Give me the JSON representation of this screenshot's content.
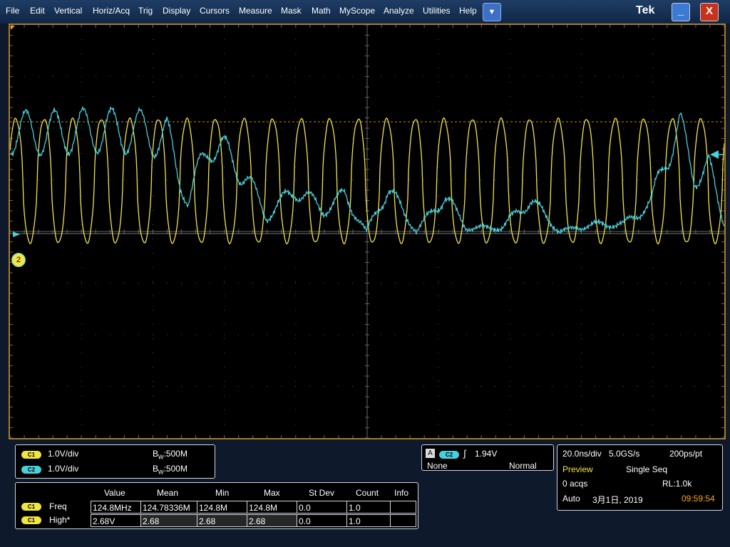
{
  "menu": {
    "items": [
      "File",
      "Edit",
      "Vertical",
      "Horiz/Acq",
      "Trig",
      "Display",
      "Cursors",
      "Measure",
      "Mask",
      "Math",
      "MyScope",
      "Analyze",
      "Utilities",
      "Help"
    ],
    "dropdown_glyph": "▼",
    "brand": "Tek",
    "minimize_glyph": "_",
    "close_glyph": "X"
  },
  "channels": {
    "c1": {
      "label": "C1",
      "scale": "1.0V/div",
      "bw": "500M",
      "bw_prefix": "B",
      "bw_sub": "W",
      "color": "#f3e44a"
    },
    "c2": {
      "label": "C2",
      "scale": "1.0V/div",
      "bw": "500M",
      "bw_prefix": "B",
      "bw_sub": "W",
      "color": "#48d0dd"
    },
    "ch2_marker": "2"
  },
  "trigger": {
    "badge": "A",
    "source": "C2",
    "level": "1.94V",
    "mode_left": "None",
    "mode_right": "Normal"
  },
  "acquisition": {
    "timebase": "20.0ns/div",
    "sample_rate": "5.0GS/s",
    "resolution": "200ps/pt",
    "preview": "Preview",
    "seq_mode": "Single Seq",
    "acqs": "0 acqs",
    "record_length": "RL:1.0k",
    "trigger_mode": "Auto",
    "date": "3月1日, 2019",
    "time": "09:59:54"
  },
  "measurements": {
    "headers": [
      "Value",
      "Mean",
      "Min",
      "Max",
      "St Dev",
      "Count",
      "Info"
    ],
    "rows": [
      {
        "channel": "C1",
        "name": "Freq",
        "value": "124.8MHz",
        "mean": "124.78336M",
        "min": "124.8M",
        "max": "124.8M",
        "stdev": "0.0",
        "count": "1.0",
        "info": ""
      },
      {
        "channel": "C1",
        "name": "High*",
        "value": "2.68V",
        "mean": "2.68",
        "min": "2.68",
        "max": "2.68",
        "stdev": "0.0",
        "count": "1.0",
        "info": ""
      }
    ]
  }
}
